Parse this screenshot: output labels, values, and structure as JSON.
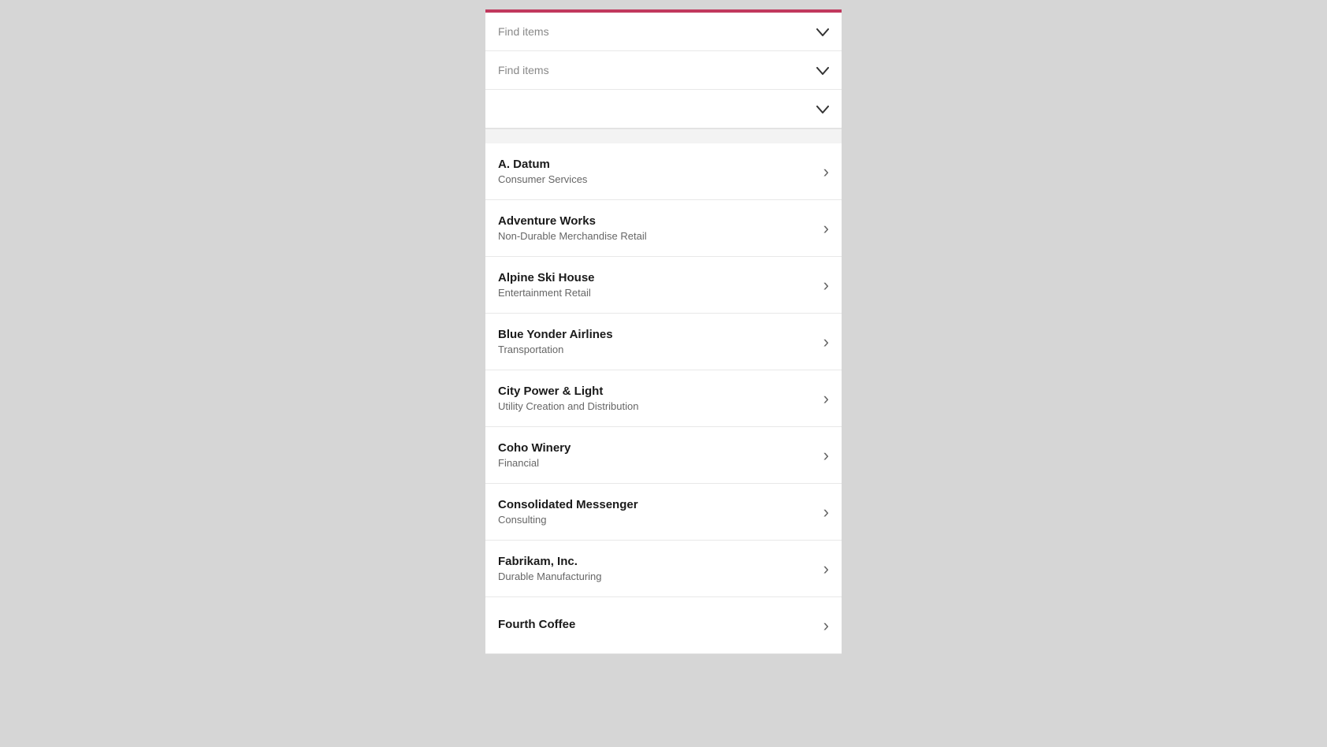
{
  "filters": [
    {
      "id": "filter1",
      "placeholder": "Find items"
    },
    {
      "id": "filter2",
      "placeholder": "Find items"
    },
    {
      "id": "filter3",
      "placeholder": ""
    }
  ],
  "list_items": [
    {
      "id": "a-datum",
      "title": "A. Datum",
      "subtitle": "Consumer Services"
    },
    {
      "id": "adventure-works",
      "title": "Adventure Works",
      "subtitle": "Non-Durable Merchandise Retail"
    },
    {
      "id": "alpine-ski-house",
      "title": "Alpine Ski House",
      "subtitle": "Entertainment Retail"
    },
    {
      "id": "blue-yonder-airlines",
      "title": "Blue Yonder Airlines",
      "subtitle": "Transportation"
    },
    {
      "id": "city-power-light",
      "title": "City Power & Light",
      "subtitle": "Utility Creation and Distribution"
    },
    {
      "id": "coho-winery",
      "title": "Coho Winery",
      "subtitle": "Financial"
    },
    {
      "id": "consolidated-messenger",
      "title": "Consolidated Messenger",
      "subtitle": "Consulting"
    },
    {
      "id": "fabrikam-inc",
      "title": "Fabrikam, Inc.",
      "subtitle": "Durable Manufacturing"
    },
    {
      "id": "fourth-coffee",
      "title": "Fourth Coffee",
      "subtitle": ""
    }
  ],
  "icons": {
    "chevron_down": "⌄",
    "chevron_right": "›"
  }
}
